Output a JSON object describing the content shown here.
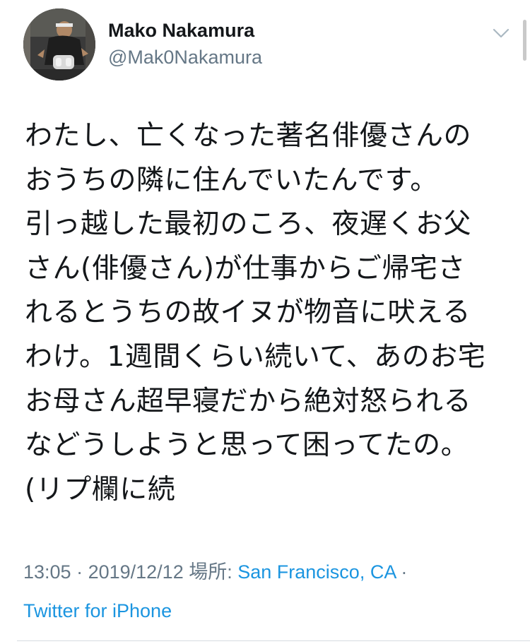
{
  "tweet": {
    "author": {
      "display_name": "Mako Nakamura",
      "handle": "@Mak0Nakamura"
    },
    "menu_icon": "chevron-down-icon",
    "body_lines": [
      "わたし、亡くなった著名俳優さんの",
      "おうちの隣に住んでいたんです。",
      "引っ越した最初のころ、夜遅くお父",
      "さん(俳優さん)が仕事からご帰宅さ",
      "れるとうちの故イヌが物音に吠える",
      "わけ。1週間くらい続いて、あのお宅",
      "お母さん超早寝だから絶対怒られる",
      "などうしようと思って困ってたの。",
      "(リプ欄に続"
    ],
    "meta": {
      "time": "13:05",
      "separator": " · ",
      "date": "2019/12/12",
      "location_label": "場所: ",
      "location": "San Francisco, CA",
      "trailing_separator": " ·",
      "source": "Twitter for iPhone"
    }
  },
  "colors": {
    "text": "#14171a",
    "secondary": "#657786",
    "link": "#1b95e0",
    "divider": "#d6dbe0"
  }
}
